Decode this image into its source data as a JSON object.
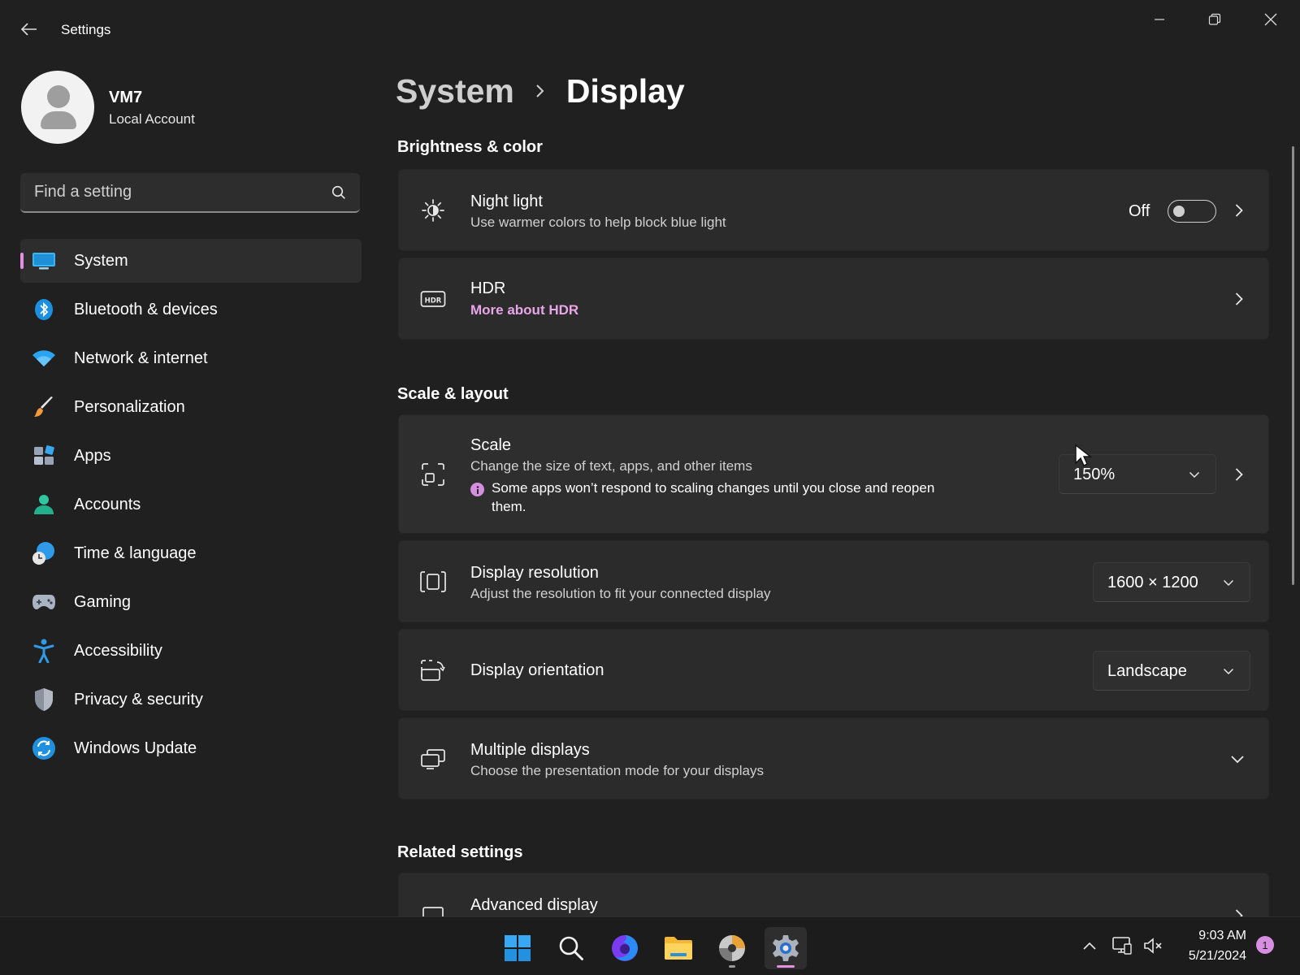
{
  "window": {
    "title": "Settings"
  },
  "profile": {
    "name": "VM7",
    "account_type": "Local Account"
  },
  "search": {
    "placeholder": "Find a setting"
  },
  "sidebar": {
    "items": [
      {
        "label": "System",
        "icon": "system-display-icon",
        "active": true
      },
      {
        "label": "Bluetooth & devices",
        "icon": "bluetooth-icon"
      },
      {
        "label": "Network & internet",
        "icon": "wifi-icon"
      },
      {
        "label": "Personalization",
        "icon": "paintbrush-icon"
      },
      {
        "label": "Apps",
        "icon": "apps-icon"
      },
      {
        "label": "Accounts",
        "icon": "accounts-icon"
      },
      {
        "label": "Time & language",
        "icon": "time-language-icon"
      },
      {
        "label": "Gaming",
        "icon": "gamepad-icon"
      },
      {
        "label": "Accessibility",
        "icon": "accessibility-icon"
      },
      {
        "label": "Privacy & security",
        "icon": "shield-icon"
      },
      {
        "label": "Windows Update",
        "icon": "windows-update-icon"
      }
    ]
  },
  "breadcrumb": {
    "parent": "System",
    "current": "Display"
  },
  "sections": {
    "brightness": "Brightness & color",
    "scale_layout": "Scale & layout",
    "related": "Related settings"
  },
  "cards": {
    "night_light": {
      "title": "Night light",
      "desc": "Use warmer colors to help block blue light",
      "toggle_state": "Off"
    },
    "hdr": {
      "title": "HDR",
      "link": "More about HDR"
    },
    "scale": {
      "title": "Scale",
      "desc": "Change the size of text, apps, and other items",
      "note_line1": "Some apps won’t respond to scaling changes until you close and reopen",
      "note_line2": "them.",
      "value": "150%"
    },
    "resolution": {
      "title": "Display resolution",
      "desc": "Adjust the resolution to fit your connected display",
      "value": "1600 × 1200"
    },
    "orientation": {
      "title": "Display orientation",
      "value": "Landscape"
    },
    "multiple": {
      "title": "Multiple displays",
      "desc": "Choose the presentation mode for your displays"
    },
    "advanced": {
      "title": "Advanced display"
    }
  },
  "taskbar": {
    "apps": [
      "windows-start-icon",
      "search-icon",
      "firefox-icon",
      "file-explorer-icon",
      "media-disc-icon",
      "settings-gear-icon"
    ],
    "time": "9:03 AM",
    "date": "5/21/2024",
    "notification_count": "1"
  },
  "colors": {
    "accent": "#e58fe0",
    "background": "#202020",
    "card": "#2b2b2b",
    "link": "#e8a6e8"
  }
}
